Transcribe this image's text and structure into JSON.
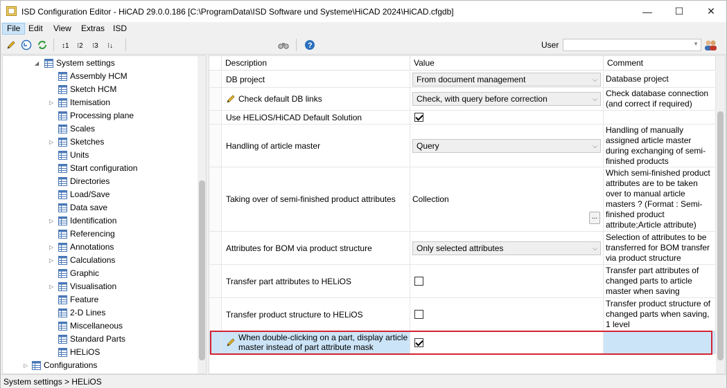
{
  "window": {
    "title": "ISD Configuration Editor  -  HiCAD 29.0.0.186 [C:\\ProgramData\\ISD Software und Systeme\\HiCAD 2024\\HiCAD.cfgdb]",
    "minimize": "—",
    "maximize": "☐",
    "close": "✕"
  },
  "menu": [
    "File",
    "Edit",
    "View",
    "Extras",
    "ISD"
  ],
  "toolbar": {
    "user_label": "User",
    "user_value": ""
  },
  "tree": {
    "root": "System settings",
    "items": [
      {
        "label": "Assembly HCM",
        "expandable": false
      },
      {
        "label": "Sketch HCM",
        "expandable": false
      },
      {
        "label": "Itemisation",
        "expandable": true
      },
      {
        "label": "Processing plane",
        "expandable": false
      },
      {
        "label": "Scales",
        "expandable": false
      },
      {
        "label": "Sketches",
        "expandable": true
      },
      {
        "label": "Units",
        "expandable": false
      },
      {
        "label": "Start configuration",
        "expandable": false
      },
      {
        "label": "Directories",
        "expandable": false
      },
      {
        "label": "Load/Save",
        "expandable": false
      },
      {
        "label": "Data save",
        "expandable": false
      },
      {
        "label": "Identification",
        "expandable": true
      },
      {
        "label": "Referencing",
        "expandable": false
      },
      {
        "label": "Annotations",
        "expandable": true
      },
      {
        "label": "Calculations",
        "expandable": true
      },
      {
        "label": "Graphic",
        "expandable": false
      },
      {
        "label": "Visualisation",
        "expandable": true
      },
      {
        "label": "Feature",
        "expandable": false
      },
      {
        "label": "2-D Lines",
        "expandable": false
      },
      {
        "label": "Miscellaneous",
        "expandable": false
      },
      {
        "label": "Standard Parts",
        "expandable": false
      },
      {
        "label": "HELiOS",
        "expandable": false
      }
    ],
    "configurations": "Configurations"
  },
  "grid": {
    "headers": {
      "description": "Description",
      "value": "Value",
      "comment": "Comment"
    },
    "rows": [
      {
        "description": "DB project",
        "type": "combo",
        "value": "From document management",
        "comment": "Database project",
        "pencil": false
      },
      {
        "description": "Check default DB links",
        "type": "combo",
        "value": "Check, with query before correction",
        "comment": "Check database connection (and correct if required)",
        "pencil": true
      },
      {
        "description": "Use HELiOS/HiCAD Default Solution",
        "type": "checkbox",
        "checked": true,
        "comment": "",
        "pencil": false
      },
      {
        "description": "Handling of article master",
        "type": "combo",
        "value": "Query",
        "comment": "Handling of manually assigned article master during exchanging of semi-finished products",
        "pencil": false
      },
      {
        "description": "Taking over of semi-finished product attributes",
        "type": "text",
        "value": "Collection",
        "button": "...",
        "comment": "Which semi-finished product attributes are to be taken over to manual article masters ? (Format : Semi-finished product attribute;Article attribute)",
        "pencil": false
      },
      {
        "description": "Attributes for BOM via product structure",
        "type": "combo",
        "value": "Only selected attributes",
        "comment": "Selection of attributes to be transferred for BOM transfer via product structure",
        "pencil": false
      },
      {
        "description": "Transfer part attributes to HELiOS",
        "type": "checkbox",
        "checked": false,
        "comment": "Transfer part attributes of changed parts to article master when saving",
        "pencil": false
      },
      {
        "description": "Transfer product structure to HELiOS",
        "type": "checkbox",
        "checked": false,
        "comment": "Transfer product structure of changed parts when saving, 1 level",
        "pencil": false
      },
      {
        "description": "When double-clicking on a part, display article master instead of part attribute mask",
        "type": "checkbox",
        "checked": true,
        "comment": "",
        "pencil": true,
        "selected": true
      }
    ]
  },
  "status": "System settings > HELiOS",
  "colors": {
    "selection": "#cce4f7",
    "highlight_border": "#d42333"
  }
}
